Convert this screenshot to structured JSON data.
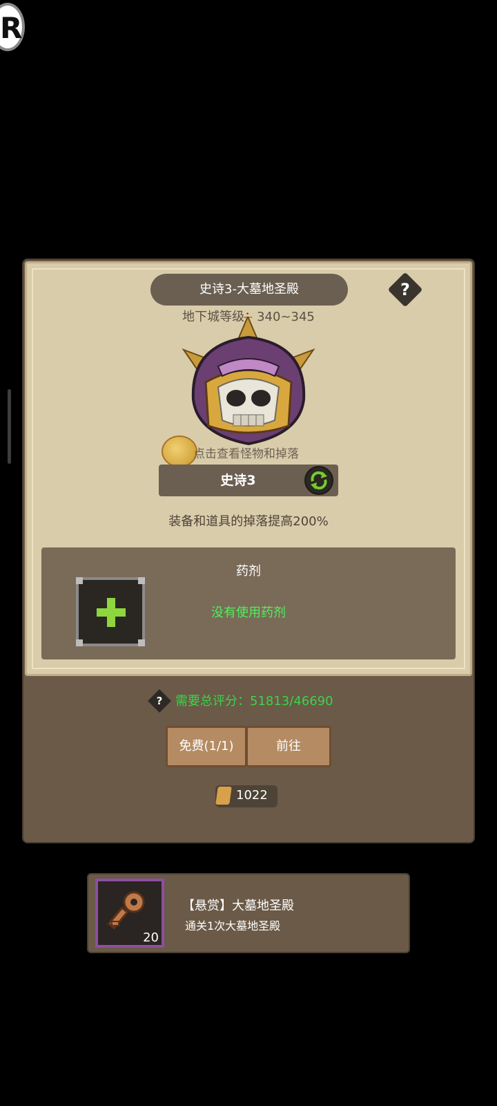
{
  "corner_logo": "R",
  "dungeon": {
    "title": "史诗3-大墓地圣殿",
    "help": "?",
    "level": "地下城等级：340~345",
    "check_monsters": "点击查看怪物和掉落",
    "difficulty": "史诗3",
    "drop_bonus": "装备和道具的掉落提高200%"
  },
  "potion": {
    "title": "药剂",
    "status": "没有使用药剂"
  },
  "requirement": {
    "help": "?",
    "text": "需要总评分：51813/46690"
  },
  "buttons": {
    "free": "免费(1/1)",
    "go": "前往"
  },
  "tickets": "1022",
  "bounty": {
    "title": "【悬赏】大墓地圣殿",
    "desc": "通关1次大墓地圣殿",
    "count": "20"
  },
  "colors": {
    "panel": "#6a5a47",
    "paper": "#d9ccaa",
    "accent_green": "#3cd34a",
    "potion_plus": "#8ed63e",
    "bounty_border": "#8c4fa0"
  },
  "icons": [
    "help-icon",
    "coin-icon",
    "swap-icon",
    "plus-icon",
    "ticket-icon",
    "key-icon"
  ]
}
